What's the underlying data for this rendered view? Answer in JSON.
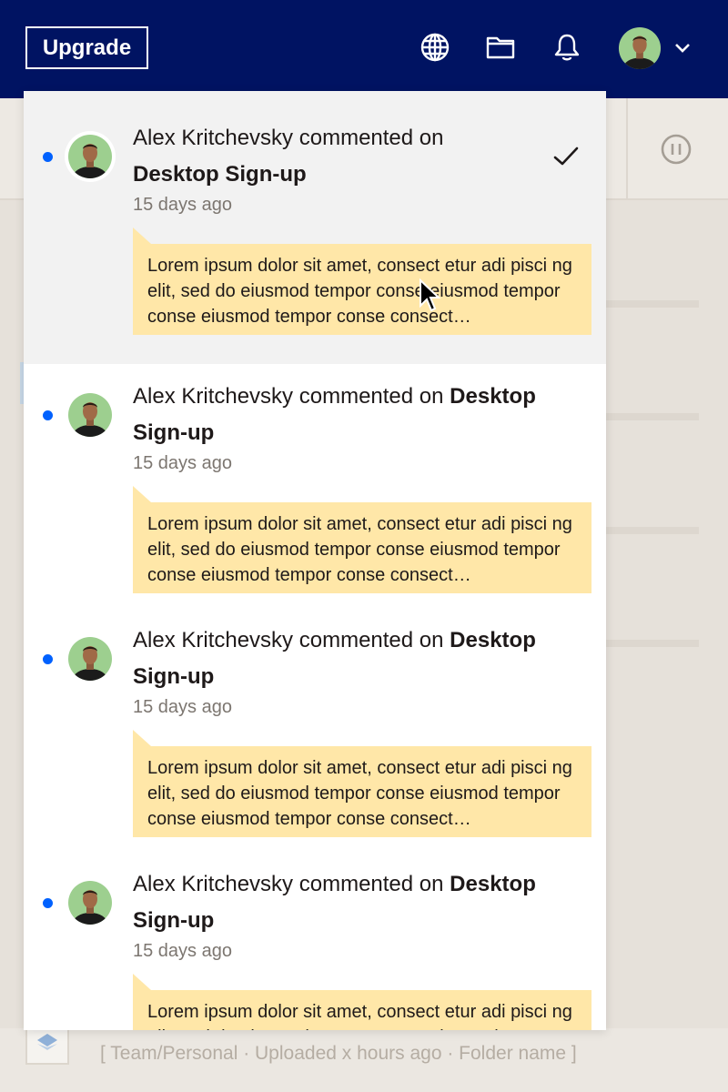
{
  "header": {
    "upgrade_label": "Upgrade",
    "icons": [
      "globe-icon",
      "folder-icon",
      "bell-icon",
      "chevron-down-icon"
    ]
  },
  "notifications": [
    {
      "actor": "Alex Kritchevsky",
      "action": "commented on",
      "target": "Desktop Sign-up",
      "time": "15 days ago",
      "comment": "Lorem ipsum dolor sit amet, consect etur adi pisci ng elit, sed do eiusmod tempor conse eiusmod tempor conse eiusmod tempor conse consect…"
    },
    {
      "actor": "Alex Kritchevsky",
      "action": "commented on",
      "target_line1": "Desktop",
      "target_line2": "Sign-up",
      "time": "15 days ago",
      "comment": "Lorem ipsum dolor sit amet, consect etur adi pisci ng elit, sed do eiusmod tempor conse eiusmod tempor conse eiusmod tempor conse consect…"
    },
    {
      "actor": "Alex Kritchevsky",
      "action": "commented on",
      "target_line1": "Desktop",
      "target_line2": "Sign-up",
      "time": "15 days ago",
      "comment": "Lorem ipsum dolor sit amet, consect etur adi pisci ng elit, sed do eiusmod tempor conse eiusmod tempor conse eiusmod tempor conse consect…"
    },
    {
      "actor": "Alex Kritchevsky",
      "action": "commented on",
      "target_line1": "Desktop",
      "target_line2": "Sign-up",
      "time": "15 days ago",
      "comment": "Lorem ipsum dolor sit amet, consect etur adi pisci ng elit, sed do eiusmod tempor conse eiusmod tempor conse eiusmod tempor conse consect…"
    }
  ],
  "background": {
    "file_meta": "[ Team/Personal  ·  Uploaded x hours ago  ·  Folder name ]"
  },
  "colors": {
    "topbar": "#001362",
    "unread_dot": "#0061fe",
    "comment_bg": "#ffe7a8",
    "hover_row": "#f2f2f2"
  }
}
